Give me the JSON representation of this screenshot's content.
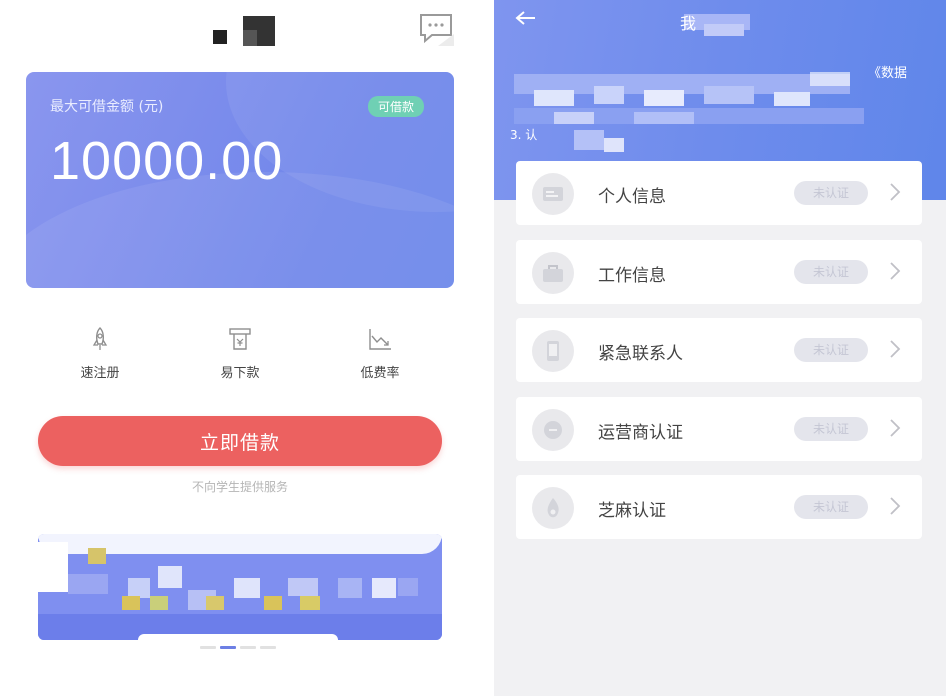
{
  "left": {
    "header_icon": "message-icon",
    "card": {
      "label": "最大可借金额 (元)",
      "badge": "可借款",
      "amount": "10000.00"
    },
    "features": [
      {
        "icon": "rocket-icon",
        "label": "速注册"
      },
      {
        "icon": "cash-withdraw-icon",
        "label": "易下款"
      },
      {
        "icon": "trend-chart-icon",
        "label": "低费率"
      }
    ],
    "borrow_button": "立即借款",
    "notice": "不向学生提供服务"
  },
  "right": {
    "header": {
      "title": "我",
      "back_icon": "back-arrow-icon"
    },
    "hero_text_1": "《数据",
    "hero_text_2": "3. 认",
    "items": [
      {
        "label": "个人信息",
        "status": "未认证",
        "icon": "id-card-icon"
      },
      {
        "label": "工作信息",
        "status": "未认证",
        "icon": "briefcase-icon"
      },
      {
        "label": "紧急联系人",
        "status": "未认证",
        "icon": "phone-contact-icon"
      },
      {
        "label": "运营商认证",
        "status": "未认证",
        "icon": "carrier-icon"
      },
      {
        "label": "芝麻认证",
        "status": "未认证",
        "icon": "sesame-icon"
      }
    ]
  },
  "colors": {
    "card_gradient": "#7b8cec",
    "badge": "#6fd0b4",
    "borrow_button": "#ec6160",
    "hero_gradient": "#6e8cec",
    "status_pill": "#e4e5ec"
  }
}
